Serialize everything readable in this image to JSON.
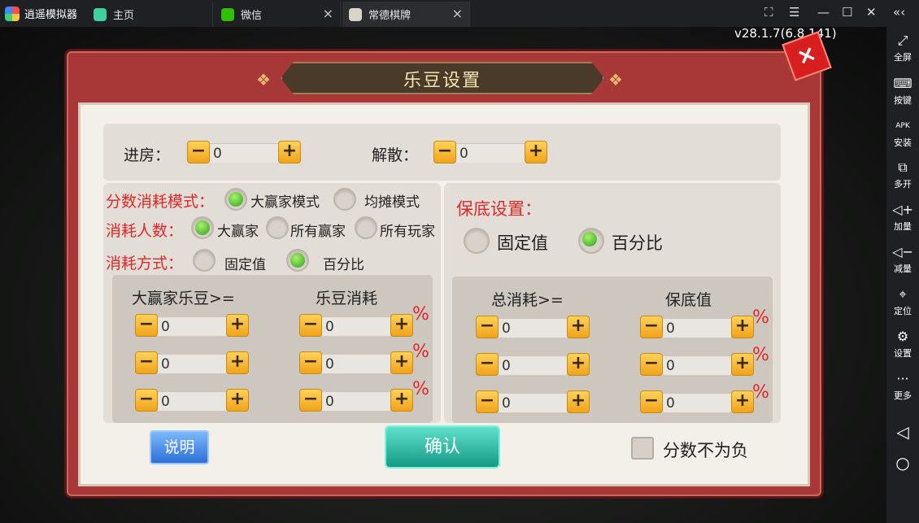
{
  "titlebar": {
    "app_name": "逍遥模拟器",
    "tabs": [
      {
        "label": "主页"
      },
      {
        "label": "微信"
      },
      {
        "label": "常德棋牌"
      }
    ]
  },
  "version": "v28.1.7(6.8.141)",
  "sidebar": [
    {
      "icon": "fullscreen-icon",
      "label": "全屏"
    },
    {
      "icon": "keyboard-icon",
      "label": "按键"
    },
    {
      "icon": "apk-icon",
      "label": "安装"
    },
    {
      "icon": "multi-open-icon",
      "label": "多开"
    },
    {
      "icon": "volume-up-icon",
      "label": "加量"
    },
    {
      "icon": "volume-down-icon",
      "label": "减量"
    },
    {
      "icon": "location-icon",
      "label": "定位"
    },
    {
      "icon": "gear-icon",
      "label": "设置"
    },
    {
      "icon": "more-icon",
      "label": "更多"
    }
  ],
  "dialog": {
    "title": "乐豆设置",
    "top": {
      "enter_label": "进房：",
      "enter_value": "0",
      "dissolve_label": "解散：",
      "dissolve_value": "0"
    },
    "left": {
      "mode_label": "分数消耗模式：",
      "mode_opt1": "大赢家模式",
      "mode_opt2": "均摊模式",
      "people_label": "消耗人数：",
      "people_opt1": "大赢家",
      "people_opt2": "所有赢家",
      "people_opt3": "所有玩家",
      "method_label": "消耗方式：",
      "method_opt1": "固定值",
      "method_opt2": "百分比",
      "col1": "大赢家乐豆>=",
      "col2": "乐豆消耗",
      "rows": [
        {
          "a": "0",
          "b": "0"
        },
        {
          "a": "0",
          "b": "0"
        },
        {
          "a": "0",
          "b": "0"
        }
      ]
    },
    "right": {
      "guarantee_label": "保底设置：",
      "opt1": "固定值",
      "opt2": "百分比",
      "col1": "总消耗>=",
      "col2": "保底值",
      "rows": [
        {
          "a": "0",
          "b": "0"
        },
        {
          "a": "0",
          "b": "0"
        },
        {
          "a": "0",
          "b": "0"
        }
      ]
    },
    "pct": "%",
    "explain_button": "说明",
    "confirm_button": "确认",
    "nonneg_label": "分数不为负",
    "minus": "−",
    "plus": "+",
    "close": "×"
  }
}
